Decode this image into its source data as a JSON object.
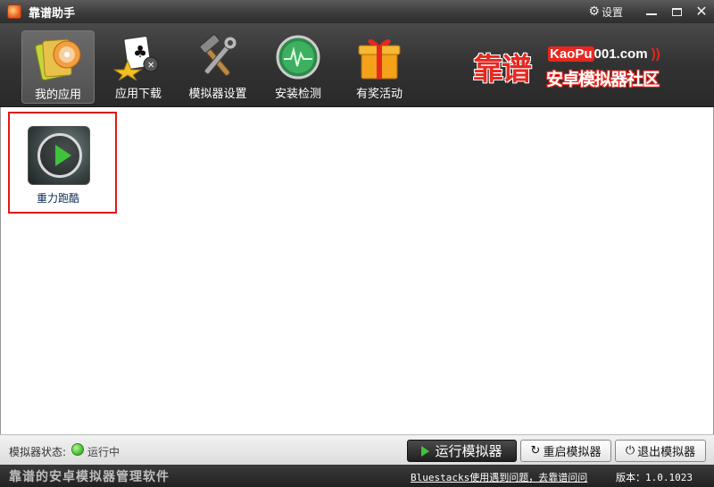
{
  "window": {
    "title": "靠谱助手",
    "settings_label": "设置",
    "icons": {
      "logo": "app-logo-icon",
      "settings": "gear-icon",
      "minimize": "minimize-icon",
      "maximize": "maximize-icon",
      "close": "close-icon"
    }
  },
  "toolbar": {
    "items": [
      {
        "label": "我的应用",
        "icon": "folder-disc-icon",
        "active": true
      },
      {
        "label": "应用下载",
        "icon": "cards-download-icon",
        "active": false
      },
      {
        "label": "模拟器设置",
        "icon": "hammer-wrench-icon",
        "active": false
      },
      {
        "label": "安装检测",
        "icon": "heartbeat-monitor-icon",
        "active": false
      },
      {
        "label": "有奖活动",
        "icon": "gift-box-icon",
        "active": false
      }
    ]
  },
  "brand": {
    "name_big": "靠谱",
    "url_prefix": "KaoPu",
    "url_suffix": "001.com",
    "subtitle": "安卓模拟器社区"
  },
  "apps": [
    {
      "name": "重力跑酷",
      "icon": "play-icon"
    }
  ],
  "status": {
    "label": "模拟器状态:",
    "value": "运行中",
    "color": "#3cb82a"
  },
  "actions": {
    "run": "运行模拟器",
    "restart": "重启模拟器",
    "quit": "退出模拟器"
  },
  "footer": {
    "slogan": "靠谱的安卓模拟器管理软件",
    "help_link": "Bluestacks使用遇到问题，去靠谱问问",
    "version": "版本：1.0.1023"
  },
  "colors": {
    "accent_red": "#e8271f",
    "play_green": "#3ec43a",
    "toolbar_bg": "#323232",
    "selection_border": "#e01818"
  }
}
